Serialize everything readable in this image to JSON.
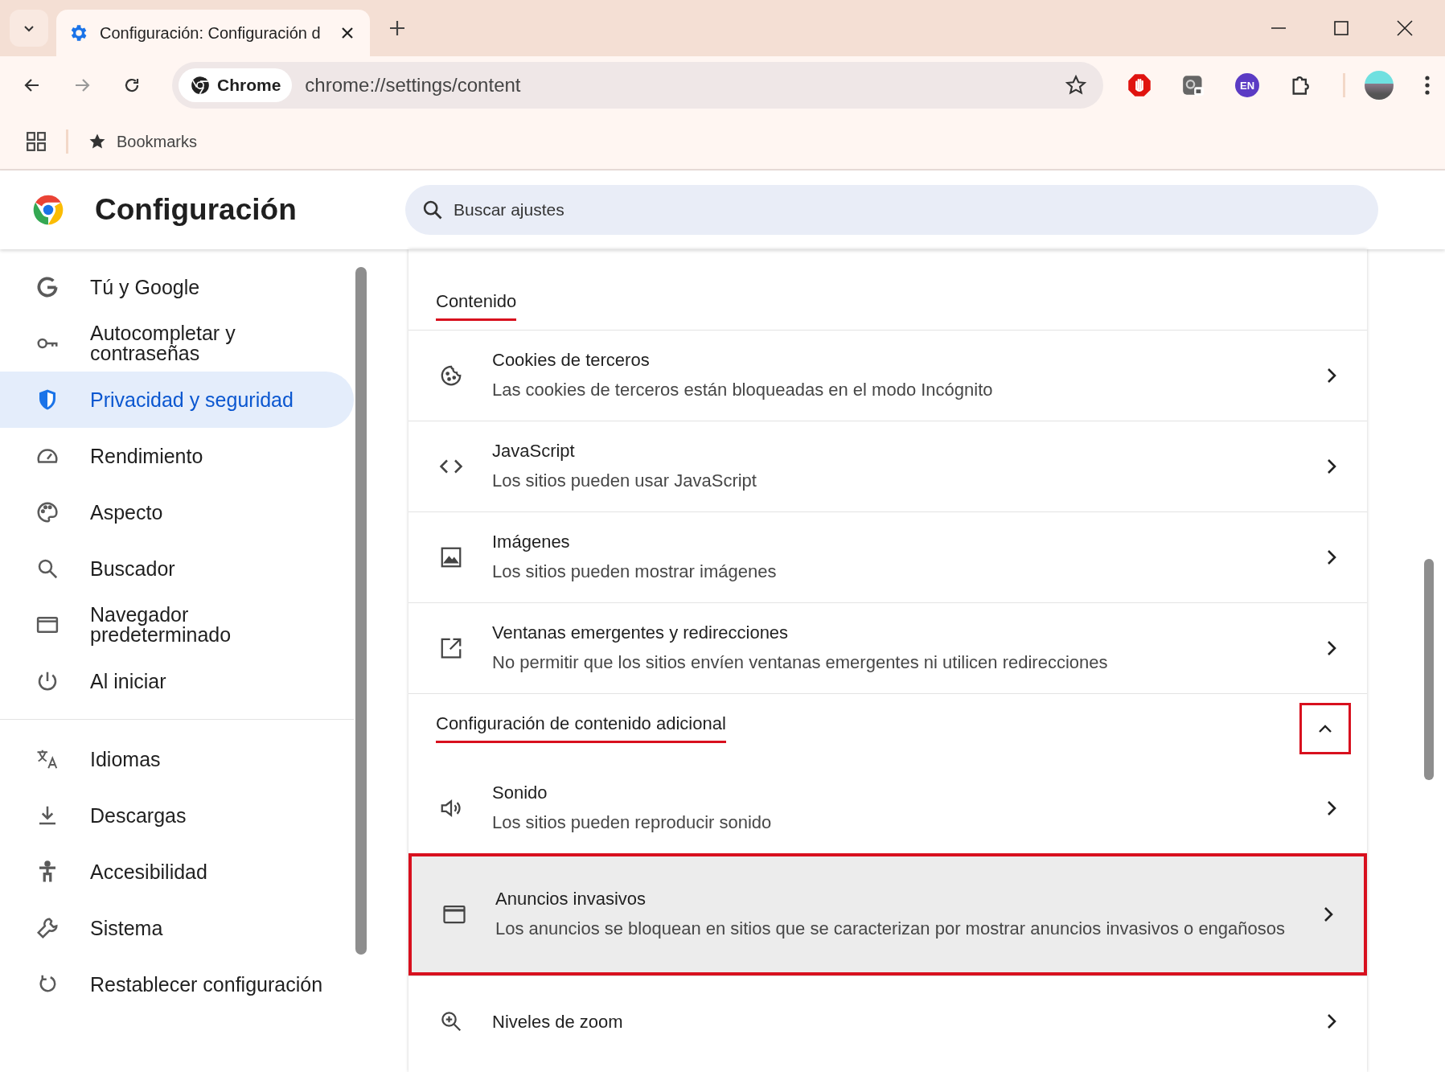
{
  "tabs": [
    {
      "title": "Configuración: Configuración d",
      "selected": true
    }
  ],
  "toolbar": {
    "chip": "Chrome",
    "url": "chrome://settings/content",
    "extension_badge": "EN"
  },
  "bookmarks_bar": {
    "label": "Bookmarks"
  },
  "header": {
    "title": "Configuración",
    "search": {
      "placeholder": "Buscar ajustes"
    }
  },
  "sidebar": {
    "groups": [
      [
        {
          "label": "Tú y Google",
          "selected": false
        },
        {
          "label": "Autocompletar y contraseñas",
          "selected": false
        },
        {
          "label": "Privacidad y seguridad",
          "selected": true
        },
        {
          "label": "Rendimiento",
          "selected": false
        },
        {
          "label": "Aspecto",
          "selected": false
        },
        {
          "label": "Buscador",
          "selected": false
        },
        {
          "label": "Navegador predeterminado",
          "selected": false
        },
        {
          "label": "Al iniciar",
          "selected": false
        }
      ],
      [
        {
          "label": "Idiomas",
          "selected": false
        },
        {
          "label": "Descargas",
          "selected": false
        },
        {
          "label": "Accesibilidad",
          "selected": false
        },
        {
          "label": "Sistema",
          "selected": false
        },
        {
          "label": "Restablecer configuración",
          "selected": false
        }
      ]
    ]
  },
  "sections": [
    {
      "heading": "Contenido",
      "underlined": true,
      "rows": [
        {
          "title": "Cookies de terceros",
          "subtitle": "Las cookies de terceros están bloqueadas en el modo Incógnito",
          "highlighted": false
        },
        {
          "title": "JavaScript",
          "subtitle": "Los sitios pueden usar JavaScript",
          "highlighted": false
        },
        {
          "title": "Imágenes",
          "subtitle": "Los sitios pueden mostrar imágenes",
          "highlighted": false
        },
        {
          "title": "Ventanas emergentes y redirecciones",
          "subtitle": "No permitir que los sitios envíen ventanas emergentes ni utilicen redirecciones",
          "highlighted": false
        }
      ]
    },
    {
      "heading": "Configuración de contenido adicional",
      "underlined": true,
      "collapsible": {
        "expanded": true,
        "highlighted": true
      },
      "rows": [
        {
          "title": "Sonido",
          "subtitle": "Los sitios pueden reproducir sonido",
          "highlighted": false
        },
        {
          "title": "Anuncios invasivos",
          "subtitle": "Los anuncios se bloquean en sitios que se caracterizan por mostrar anuncios invasivos o engañosos",
          "highlighted": true
        },
        {
          "title": "Niveles de zoom",
          "highlighted": false
        }
      ]
    }
  ]
}
